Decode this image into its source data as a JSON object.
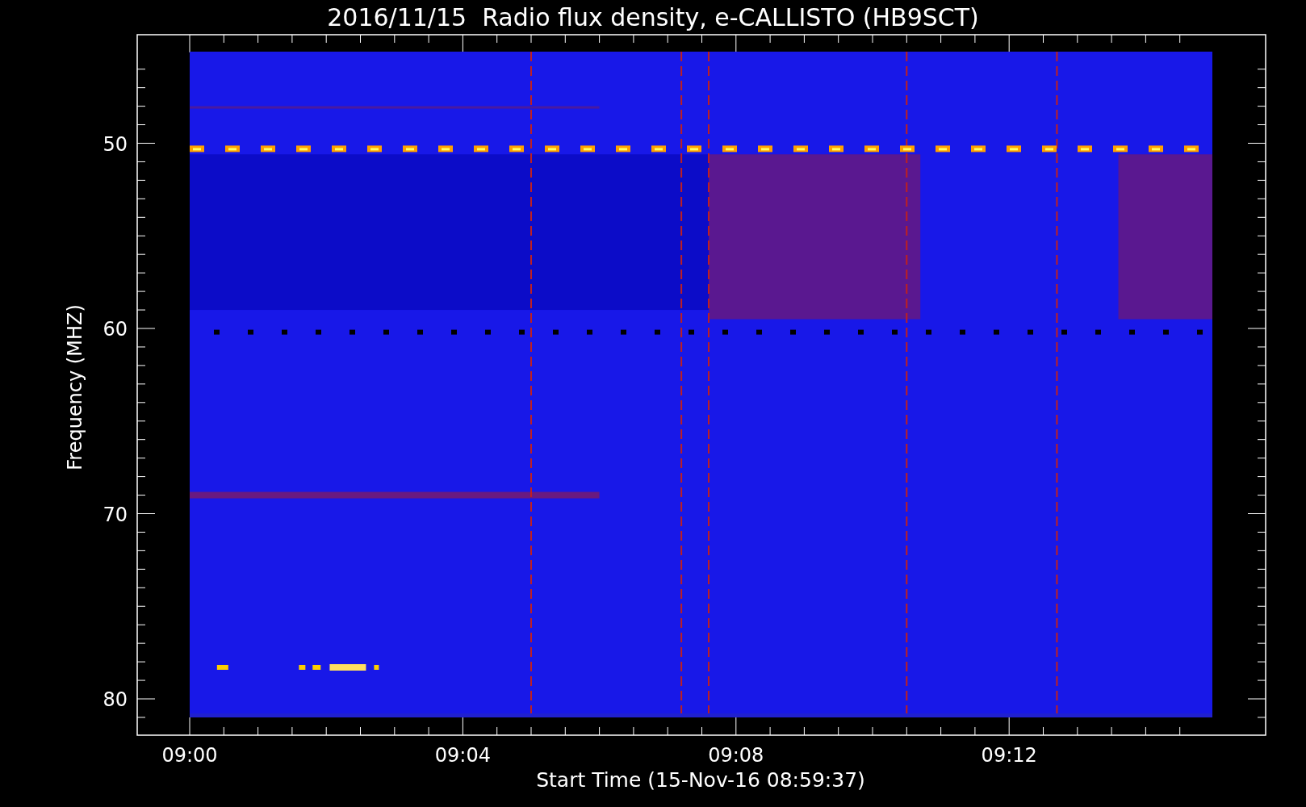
{
  "plot": {
    "title": "2016/11/15  Radio flux density, e-CALLISTO (HB9SCT)",
    "y_axis": {
      "label": "Frequency (MHZ)",
      "ticks": [
        "50",
        "60",
        "70",
        "80"
      ]
    },
    "x_axis": {
      "label": "Start Time (15-Nov-16 08:59:37)",
      "ticks": [
        "09:00",
        "09:04",
        "09:08",
        "09:12"
      ]
    }
  }
}
